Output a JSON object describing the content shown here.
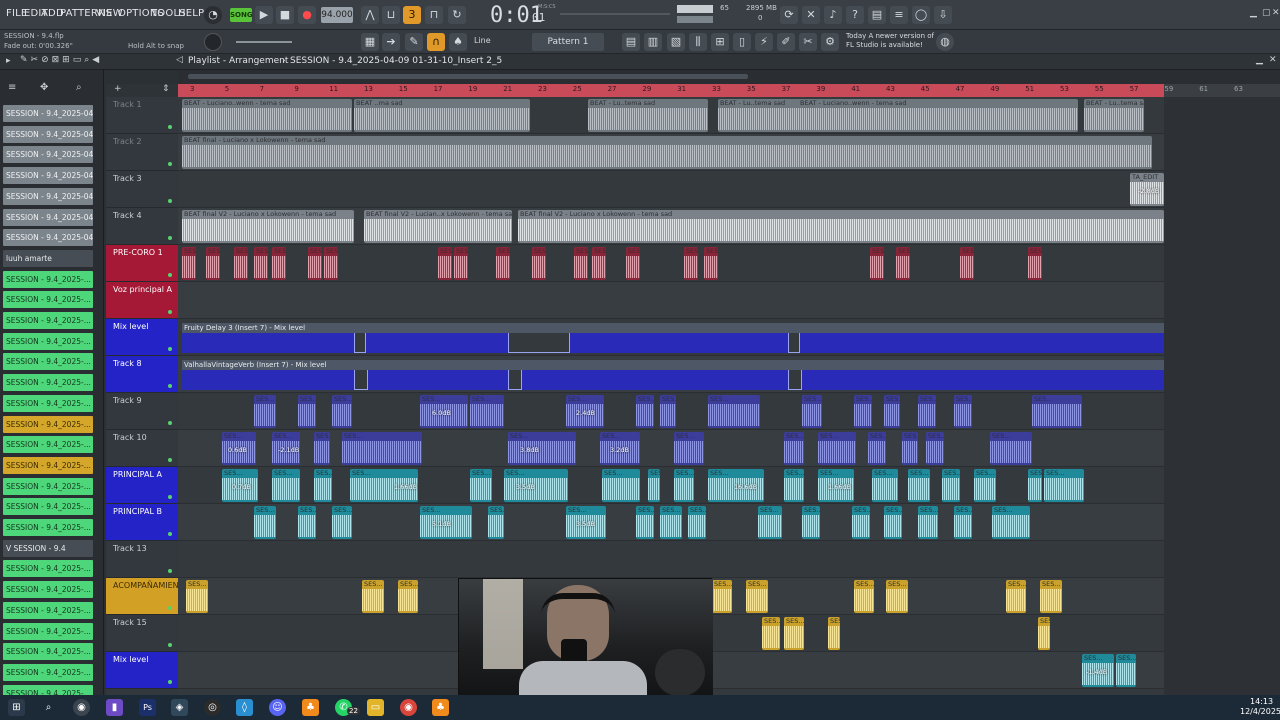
{
  "menu": [
    "FILE",
    "EDIT",
    "ADD",
    "PATTERNS",
    "VIEW",
    "OPTIONS",
    "TOOLS",
    "HELP"
  ],
  "song_label": "SONG",
  "tempo": "94.000",
  "time": "0:01",
  "time_small": "01",
  "time_units": "M:S:CS",
  "cpu_value": "65",
  "ram_value": "2895 MB",
  "ram_value2": "0",
  "snap_mode": "Line",
  "pattern_name": "Pattern 1",
  "update_notice": {
    "line1": "Today  A newer version of",
    "line2": "FL Studio is available!"
  },
  "project_file": "SESSION - 9.4.flp",
  "fade_out": "Fade out: 0'00.326\"",
  "hint": "Hold Alt to snap",
  "playlist_title": "Playlist - Arrangement",
  "playlist_breadcrumb": "SESSION - 9.4_2025-04-09 01-31-10_Insert 2_5",
  "browser_items": [
    {
      "label": "SESSION - 9.4_2025-04-...",
      "color": "gray"
    },
    {
      "label": "SESSION - 9.4_2025-04-...",
      "color": "gray"
    },
    {
      "label": "SESSION - 9.4_2025-04-...",
      "color": "gray"
    },
    {
      "label": "SESSION - 9.4_2025-04-...",
      "color": "gray"
    },
    {
      "label": "SESSION - 9.4_2025-04-...",
      "color": "gray"
    },
    {
      "label": "SESSION - 9.4_2025-04-...",
      "color": "gray"
    },
    {
      "label": "SESSION - 9.4_2025-04-...",
      "color": "gray"
    },
    {
      "label": "luuh amarte",
      "color": "dark"
    },
    {
      "label": "SESSION - 9.4_2025-...",
      "color": "green"
    },
    {
      "label": "SESSION - 9.4_2025-...",
      "color": "green"
    },
    {
      "label": "SESSION - 9.4_2025-...",
      "color": "green"
    },
    {
      "label": "SESSION - 9.4_2025-...",
      "color": "green"
    },
    {
      "label": "SESSION - 9.4_2025-...",
      "color": "green"
    },
    {
      "label": "SESSION - 9.4_2025-...",
      "color": "green"
    },
    {
      "label": "SESSION - 9.4_2025-...",
      "color": "green"
    },
    {
      "label": "SESSION - 9.4_2025-...",
      "color": "yellow"
    },
    {
      "label": "SESSION - 9.4_2025-...",
      "color": "green"
    },
    {
      "label": "SESSION - 9.4_2025-...",
      "color": "yellow"
    },
    {
      "label": "SESSION - 9.4_2025-...",
      "color": "green"
    },
    {
      "label": "SESSION - 9.4_2025-...",
      "color": "green"
    },
    {
      "label": "SESSION - 9.4_2025-...",
      "color": "green"
    },
    {
      "label": "V SESSION - 9.4",
      "color": "dark"
    },
    {
      "label": "SESSION - 9.4_2025-...",
      "color": "green"
    },
    {
      "label": "SESSION - 9.4_2025-...",
      "color": "green"
    },
    {
      "label": "SESSION - 9.4_2025-...",
      "color": "green"
    },
    {
      "label": "SESSION - 9.4_2025-...",
      "color": "green"
    },
    {
      "label": "SESSION - 9.4_2025-...",
      "color": "green"
    },
    {
      "label": "SESSION - 9.4_2025-...",
      "color": "green"
    },
    {
      "label": "SESSION - 9.4_2025-...",
      "color": "green"
    }
  ],
  "tracks": [
    {
      "name": "Track 1",
      "style": "dim"
    },
    {
      "name": "Track 2",
      "style": "dim"
    },
    {
      "name": "Track 3",
      "style": "plain"
    },
    {
      "name": "Track 4",
      "style": "plain"
    },
    {
      "name": "PRE-CORO 1",
      "style": "pink"
    },
    {
      "name": "Voz principal A",
      "style": "pink"
    },
    {
      "name": "Mix level",
      "style": "blue"
    },
    {
      "name": "Track 8",
      "style": "blue"
    },
    {
      "name": "Track 9",
      "style": "plain"
    },
    {
      "name": "Track 10",
      "style": "plain"
    },
    {
      "name": "PRINCIPAL A",
      "style": "blue"
    },
    {
      "name": "PRINCIPAL B",
      "style": "blue"
    },
    {
      "name": "Track 13",
      "style": "plain"
    },
    {
      "name": "ACOMPAÑAMIEN",
      "style": "yellow"
    },
    {
      "name": "Track 15",
      "style": "plain"
    },
    {
      "name": "Mix level",
      "style": "blue"
    }
  ],
  "ruler_bars": [
    "3",
    "5",
    "7",
    "9",
    "11",
    "13",
    "15",
    "17",
    "19",
    "21",
    "23",
    "25",
    "27",
    "29",
    "31",
    "33",
    "35",
    "37",
    "39",
    "41",
    "43",
    "45",
    "47",
    "49",
    "51",
    "53",
    "55",
    "57",
    "59",
    "61",
    "63"
  ],
  "clip_labels": {
    "beat_short": "BEAT - Luciano..wenn - tema sad",
    "beat_short2": "BEAT ..ma sad",
    "beat_lu": "BEAT - Lu..tema sad",
    "beat_final": "BEAT final - Luciano x Lokowenn - tema sad",
    "beat_v2": "BEAT final V2 - Luciano x Lokowenn - tema sad",
    "beat_v2b": "BEAT final V2 - Lucian..x Lokowenn - tema sad",
    "edit": "TA_EDIT",
    "ses": "SES..."
  },
  "automation": [
    {
      "label": "Fruity Delay 3 (Insert 7) - Mix level"
    },
    {
      "label": "ValhallaVintageVerb (Insert 7) - Mix level"
    }
  ],
  "db_labels": [
    "6.0dB",
    "2.4dB",
    "0.6dB",
    "-2.1dB",
    "3.8dB",
    "3.2dB",
    "0.7dB",
    "1.66dB",
    "3.5dB",
    "16.6dB",
    "1.66dB",
    "3.5dB",
    "5.1dB",
    "3.5dB",
    "-2.8dB",
    "3.5dB",
    "-1.4dB"
  ],
  "taskbar": {
    "time": "14:13",
    "date": "12/4/2025",
    "badge": "22"
  },
  "colors": {
    "accent_pink": "#c94a58",
    "track_blue": "#2323c8",
    "track_pink": "#a51836",
    "clip_green": "#4fd07f",
    "clip_yellow": "#caa12a"
  }
}
